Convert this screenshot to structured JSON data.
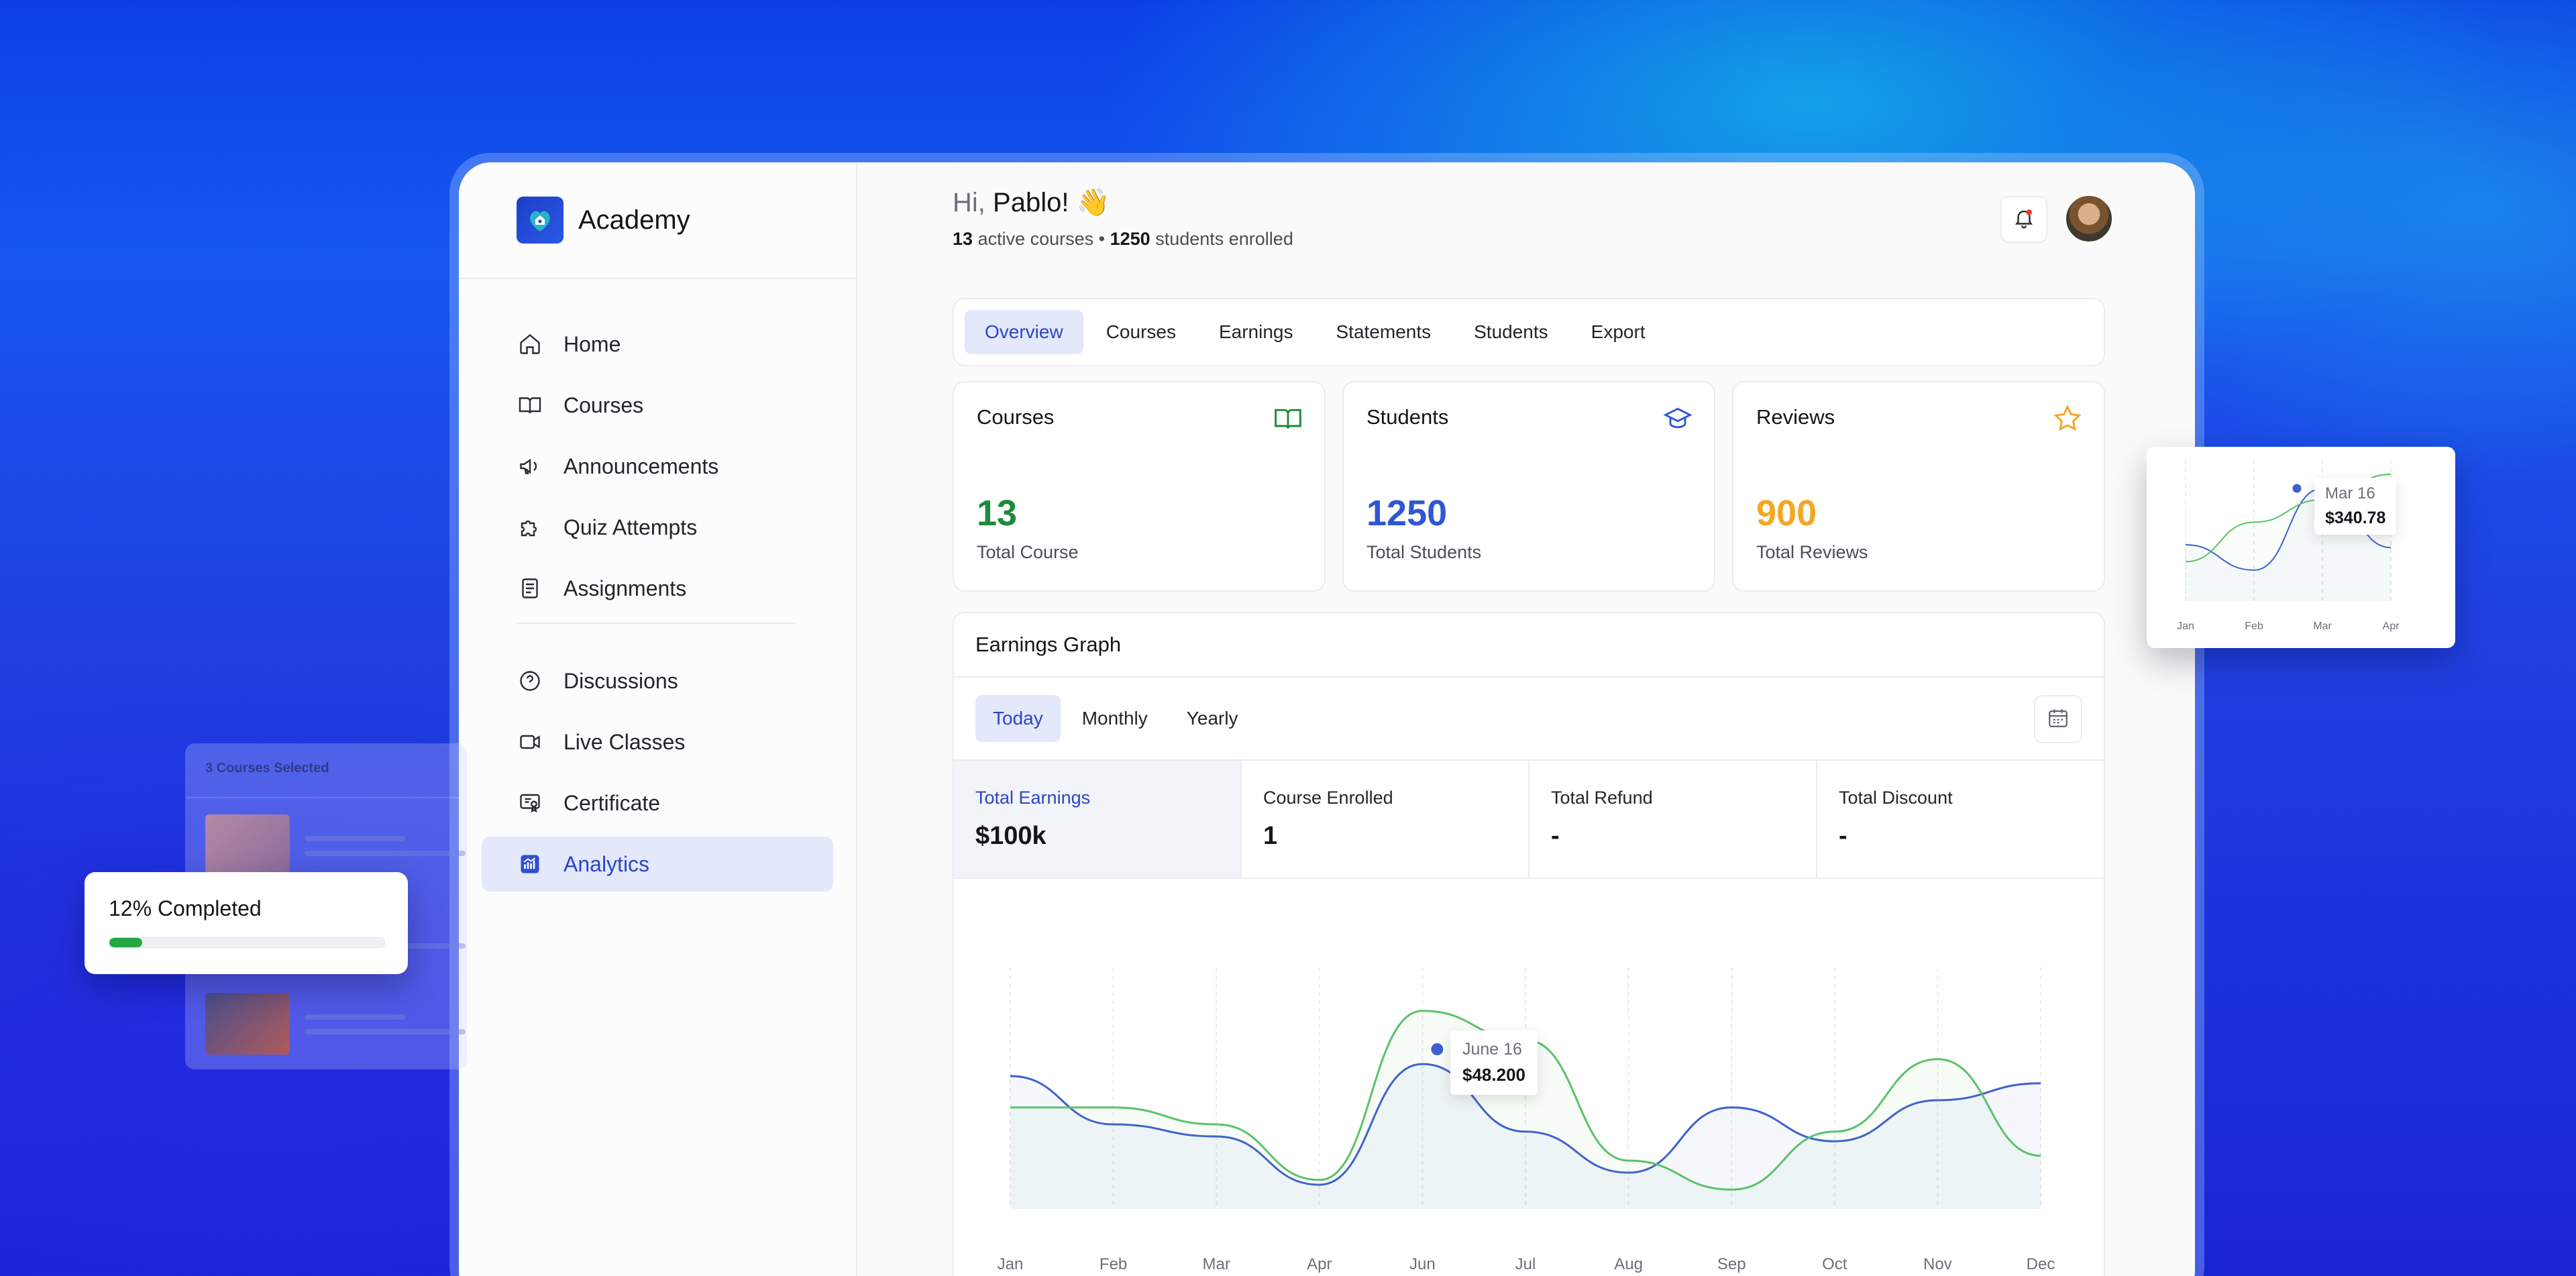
{
  "sidebar": {
    "brand": "Academy",
    "items": [
      {
        "label": "Home",
        "icon": "home-icon"
      },
      {
        "label": "Courses",
        "icon": "book-icon"
      },
      {
        "label": "Announcements",
        "icon": "megaphone-icon"
      },
      {
        "label": "Quiz Attempts",
        "icon": "puzzle-icon"
      },
      {
        "label": "Assignments",
        "icon": "document-icon"
      },
      {
        "label": "Discussions",
        "icon": "question-icon"
      },
      {
        "label": "Live Classes",
        "icon": "video-icon"
      },
      {
        "label": "Certificate",
        "icon": "certificate-icon"
      },
      {
        "label": "Analytics",
        "icon": "analytics-icon",
        "active": true
      }
    ]
  },
  "header": {
    "greeting_prefix": "Hi,",
    "greeting_name": "Pablo! 👋",
    "active_courses_count": "13",
    "active_courses_text": "active courses •",
    "students_count": "1250",
    "students_text": "students enrolled"
  },
  "tabs": [
    "Overview",
    "Courses",
    "Earnings",
    "Statements",
    "Students",
    "Export"
  ],
  "active_tab": "Overview",
  "stats": [
    {
      "title": "Courses",
      "value": "13",
      "subtitle": "Total Course",
      "color": "#1e8a3a",
      "icon": "open-book-icon"
    },
    {
      "title": "Students",
      "value": "1250",
      "subtitle": "Total Students",
      "color": "#2f56d4",
      "icon": "graduation-cap-icon"
    },
    {
      "title": "Reviews",
      "value": "900",
      "subtitle": "Total Reviews",
      "color": "#f5a623",
      "icon": "star-icon"
    }
  ],
  "earnings": {
    "title": "Earnings Graph",
    "ranges": [
      "Today",
      "Monthly",
      "Yearly"
    ],
    "active_range": "Today",
    "metrics": [
      {
        "label": "Total Earnings",
        "value": "$100k",
        "active": true
      },
      {
        "label": "Course Enrolled",
        "value": "1"
      },
      {
        "label": "Total Refund",
        "value": "-"
      },
      {
        "label": "Total Discount",
        "value": "-"
      }
    ],
    "tooltip": {
      "date": "June 16",
      "value": "$48.200"
    }
  },
  "chart_data": [
    {
      "type": "line",
      "x": [
        "Jan",
        "Feb",
        "Mar",
        "Apr",
        "Jun",
        "Jul",
        "Aug",
        "Sep",
        "Oct",
        "Nov",
        "Dec"
      ],
      "series": [
        {
          "values": [
            55,
            35,
            30,
            10,
            60,
            32,
            15,
            42,
            28,
            45,
            52
          ]
        },
        {
          "values": [
            42,
            42,
            35,
            12,
            82,
            70,
            20,
            8,
            32,
            62,
            22
          ]
        }
      ],
      "ylim": [
        0,
        100
      ],
      "grid": "vertical"
    },
    {
      "type": "line",
      "x": [
        "Jan",
        "Feb",
        "Mar",
        "Apr"
      ],
      "series": [
        {
          "values": [
            40,
            22,
            80,
            38
          ]
        },
        {
          "values": [
            28,
            56,
            72,
            90
          ]
        }
      ],
      "ylim": [
        0,
        100
      ],
      "grid": "vertical"
    }
  ],
  "mini_chart": {
    "tooltip_date": "Mar 16",
    "tooltip_value": "$340.78"
  },
  "course_panel": {
    "header": "3 Courses Selected"
  },
  "progress": {
    "label": "12% Completed",
    "percent": 12
  },
  "colors": {
    "accent": "#2a45c8",
    "green": "#5bc26a",
    "blue": "#3f5fd0"
  }
}
